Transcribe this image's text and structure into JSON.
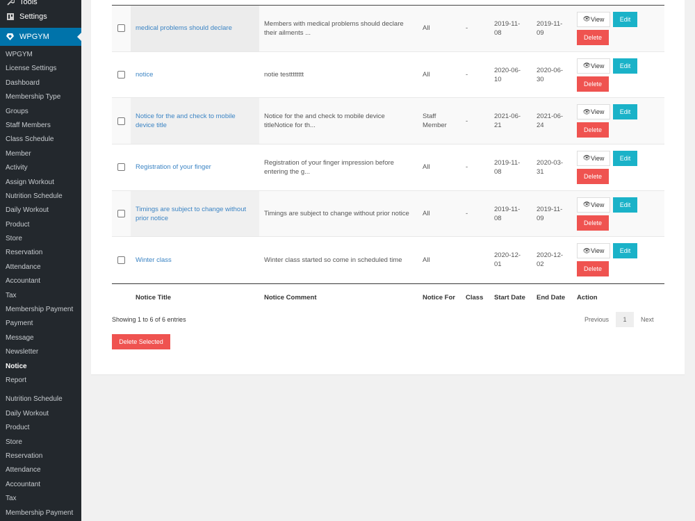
{
  "sidebar": {
    "tools_label": "Tools",
    "settings_label": "Settings",
    "active_label": "WPGYM",
    "items": [
      "WPGYM",
      "License Settings",
      "Dashboard",
      "Membership Type",
      "Groups",
      "Staff Members",
      "Class Schedule",
      "Member",
      "Activity",
      "Assign Workout",
      "Nutrition Schedule",
      "Daily Workout",
      "Product",
      "Store",
      "Reservation",
      "Attendance",
      "Accountant",
      "Tax",
      "Membership Payment",
      "Payment",
      "Message",
      "Newsletter",
      "Notice",
      "Report"
    ],
    "items2": [
      "Nutrition Schedule",
      "Daily Workout",
      "Product",
      "Store",
      "Reservation",
      "Attendance",
      "Accountant",
      "Tax",
      "Membership Payment"
    ]
  },
  "table": {
    "rows": [
      {
        "title": "medical problems should declare",
        "comment": "Members with medical problems should declare their ailments ...",
        "for": "All",
        "class": "-",
        "start": "2019-11-08",
        "end": "2019-11-09"
      },
      {
        "title": "notice",
        "comment": "notie testttttttt",
        "for": "All",
        "class": "-",
        "start": "2020-06-10",
        "end": "2020-06-30"
      },
      {
        "title": "Notice for the and check to mobile device title",
        "comment": "Notice for the and check to mobile device titleNotice for th...",
        "for": "Staff Member",
        "class": "-",
        "start": "2021-06-21",
        "end": "2021-06-24"
      },
      {
        "title": "Registration of your finger",
        "comment": "Registration of your finger impression before entering the g...",
        "for": "All",
        "class": "-",
        "start": "2019-11-08",
        "end": "2020-03-31"
      },
      {
        "title": "Timings are subject to change without prior notice",
        "comment": "Timings are subject to change without prior notice",
        "for": "All",
        "class": "-",
        "start": "2019-11-08",
        "end": "2019-11-09"
      },
      {
        "title": "Winter class",
        "comment": "Winter class started so come in scheduled time",
        "for": "All",
        "class": "",
        "start": "2020-12-01",
        "end": "2020-12-02"
      }
    ],
    "buttons": {
      "view": "View",
      "edit": "Edit",
      "delete": "Delete"
    },
    "headers": {
      "title": "Notice Title",
      "comment": "Notice Comment",
      "for": "Notice For",
      "class": "Class",
      "start": "Start Date",
      "end": "End Date",
      "action": "Action"
    }
  },
  "info": "Showing 1 to 6 of 6 entries",
  "pager": {
    "previous": "Previous",
    "page": "1",
    "next": "Next"
  },
  "delete_selected": "Delete Selected",
  "colors": {
    "accent": "#0073aa",
    "edit": "#1ab2c8",
    "delete": "#ef5350",
    "link": "#3b84c4"
  }
}
